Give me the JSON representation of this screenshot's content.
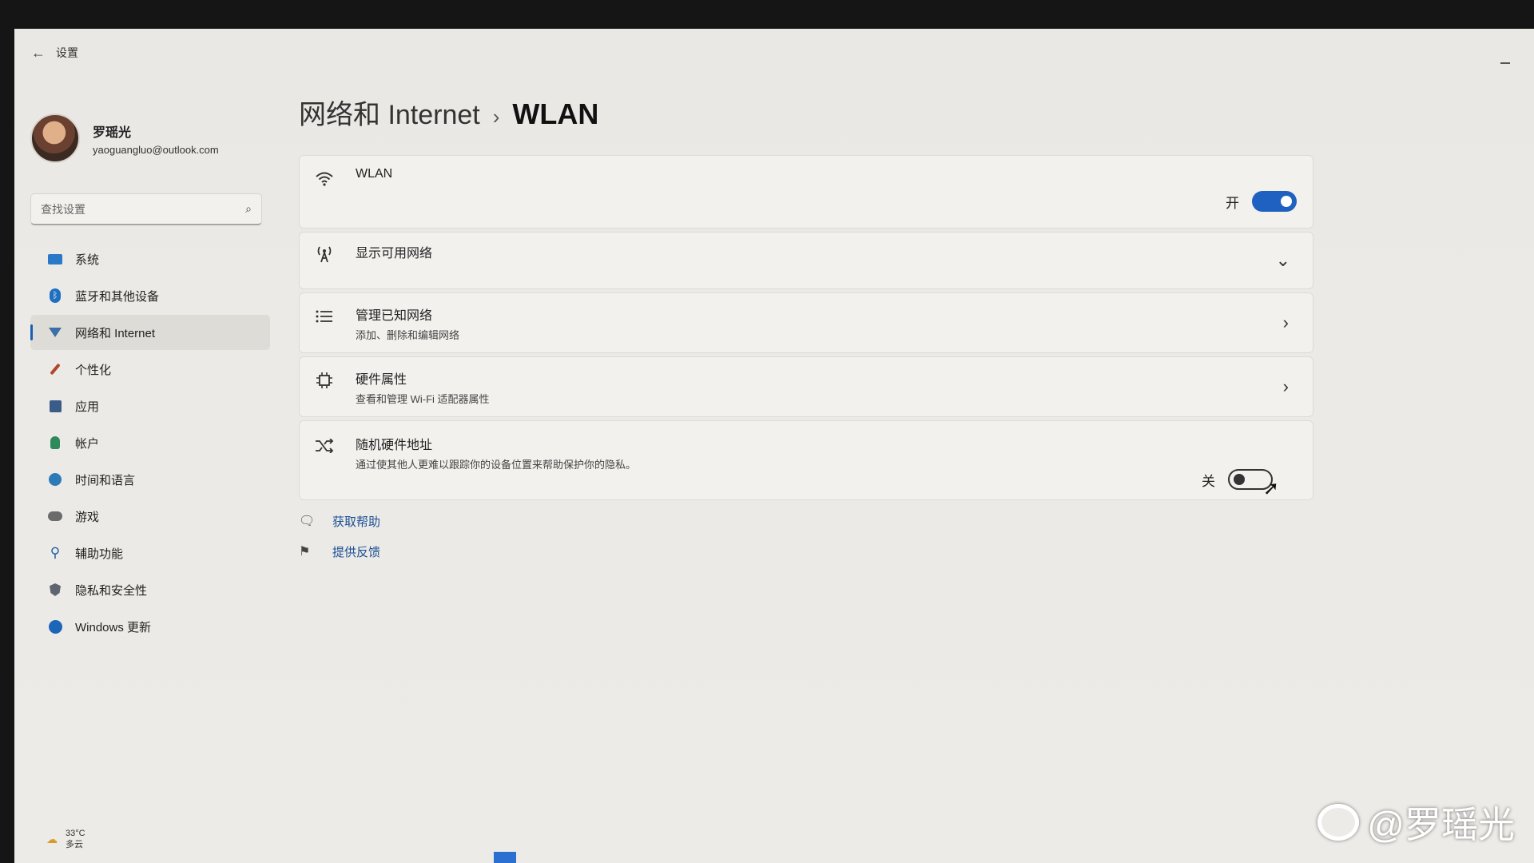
{
  "app": {
    "title": "设置",
    "back_icon": "arrow-left-icon"
  },
  "profile": {
    "name": "罗瑶光",
    "email": "yaoguangluo@outlook.com"
  },
  "search": {
    "placeholder": "查找设置",
    "icon": "search-icon"
  },
  "nav": {
    "items": [
      {
        "label": "系统",
        "icon": "system-icon"
      },
      {
        "label": "蓝牙和其他设备",
        "icon": "bluetooth-icon"
      },
      {
        "label": "网络和 Internet",
        "icon": "network-icon",
        "active": true
      },
      {
        "label": "个性化",
        "icon": "brush-icon"
      },
      {
        "label": "应用",
        "icon": "apps-icon"
      },
      {
        "label": "帐户",
        "icon": "account-icon"
      },
      {
        "label": "时间和语言",
        "icon": "globe-clock-icon"
      },
      {
        "label": "游戏",
        "icon": "gamepad-icon"
      },
      {
        "label": "辅助功能",
        "icon": "accessibility-icon"
      },
      {
        "label": "隐私和安全性",
        "icon": "shield-icon"
      },
      {
        "label": "Windows 更新",
        "icon": "update-icon"
      }
    ]
  },
  "weather": {
    "temp": "33°C",
    "condition": "多云"
  },
  "breadcrumb": {
    "parent": "网络和 Internet",
    "separator": "›",
    "current": "WLAN"
  },
  "wlan": {
    "title": "WLAN",
    "toggle_label": "开",
    "toggle_state": "on"
  },
  "show_networks": {
    "title": "显示可用网络"
  },
  "manage_known": {
    "title": "管理已知网络",
    "subtitle": "添加、删除和编辑网络"
  },
  "hardware": {
    "title": "硬件属性",
    "subtitle": "查看和管理 Wi-Fi 适配器属性"
  },
  "random_mac": {
    "title": "随机硬件地址",
    "subtitle": "通过使其他人更难以跟踪你的设备位置来帮助保护你的隐私。",
    "toggle_label": "关",
    "toggle_state": "off"
  },
  "links": {
    "help": "获取帮助",
    "feedback": "提供反馈"
  },
  "watermark": {
    "text": "@罗瑶光"
  },
  "colors": {
    "accent": "#1f61c0",
    "link": "#1a4f96"
  }
}
